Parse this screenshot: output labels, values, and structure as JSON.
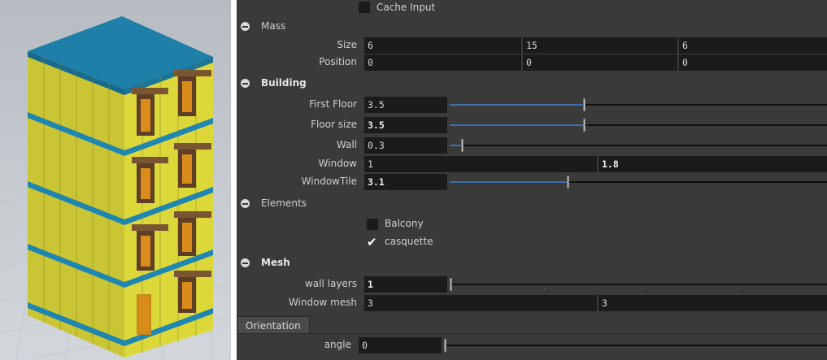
{
  "cache_input": {
    "label": "Cache Input",
    "checked": false
  },
  "mass": {
    "title": "Mass",
    "size": {
      "label": "Size",
      "values": [
        "6",
        "15",
        "6"
      ]
    },
    "position": {
      "label": "Position",
      "values": [
        "0",
        "0",
        "0"
      ]
    }
  },
  "building": {
    "title": "Building",
    "first_floor": {
      "label": "First Floor",
      "value": "3.5",
      "slider_fraction": 0.35
    },
    "floor_size": {
      "label": "Floor size",
      "value": "3.5",
      "slider_fraction": 0.35
    },
    "wall": {
      "label": "Wall",
      "value": "0.3",
      "slider_fraction": 0.03
    },
    "window": {
      "label": "Window",
      "values": [
        "1",
        "1.8"
      ]
    },
    "window_tile": {
      "label": "WindowTile",
      "value": "3.1",
      "slider_fraction": 0.31
    }
  },
  "elements": {
    "title": "Elements",
    "balcony": {
      "label": "Balcony",
      "checked": false
    },
    "casquette": {
      "label": "casquette",
      "checked": true
    }
  },
  "mesh": {
    "title": "Mesh",
    "wall_layers": {
      "label": "wall layers",
      "value": "1",
      "slider_fraction": 0.0
    },
    "window_mesh": {
      "label": "Window mesh",
      "values": [
        "3",
        "3"
      ]
    }
  },
  "orientation_tab": {
    "label": "Orientation"
  },
  "orientation": {
    "angle": {
      "label": "angle",
      "value": "0",
      "slider_fraction": 0.0
    }
  },
  "icons": {
    "collapse": "minus-circle-icon",
    "check": "checkmark-icon"
  },
  "colors": {
    "panel_bg": "#3a3a3a",
    "field_bg": "#1b1b1b",
    "slider_fill": "#3a6fa8",
    "building_wall": "#d6d23a",
    "building_roof": "#1e7fa8",
    "window_frame": "#6b4a2e",
    "window_glass": "#d98c1a"
  }
}
